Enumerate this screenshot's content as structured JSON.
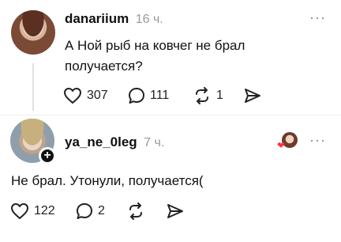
{
  "post1": {
    "username": "danariium",
    "time": "16 ч.",
    "text_line1": "А Ной рыб на ковчег не брал",
    "text_line2": "получается?",
    "likes": "307",
    "comments": "111",
    "reposts": "1"
  },
  "post2": {
    "username": "ya_ne_0leg",
    "time": "7 ч.",
    "text": "Не брал. Утонули, получается(",
    "likes": "122",
    "comments": "2"
  },
  "menu_label": "···",
  "icons": {
    "like": "heart-icon",
    "comment": "comment-icon",
    "repost": "repost-icon",
    "share": "share-icon",
    "more": "more-icon",
    "follow": "plus-icon"
  },
  "colors": {
    "accent_heart": "#ff3040",
    "text_secondary": "#9a9a9a"
  }
}
